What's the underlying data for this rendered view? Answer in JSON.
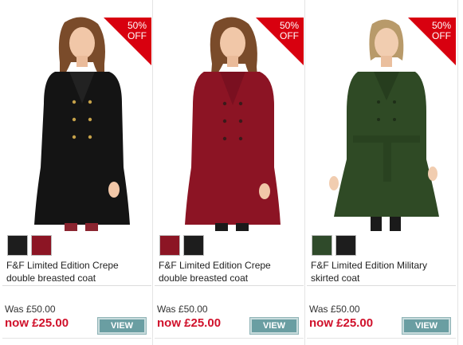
{
  "products": [
    {
      "badge": [
        "50%",
        "OFF"
      ],
      "coat_color": "#141414",
      "swatches": [
        "#1d1d1d",
        "#8c1524"
      ],
      "name": "F&F Limited Edition Crepe double breasted coat",
      "was": "Was £50.00",
      "now": "now £25.00",
      "view": "VIEW"
    },
    {
      "badge": [
        "50%",
        "OFF"
      ],
      "coat_color": "#8c1424",
      "swatches": [
        "#8c1524",
        "#1d1d1d"
      ],
      "name": "F&F Limited Edition Crepe double breasted coat",
      "was": "Was £50.00",
      "now": "now £25.00",
      "view": "VIEW"
    },
    {
      "badge": [
        "50%",
        "OFF"
      ],
      "coat_color": "#2f4a25",
      "swatches": [
        "#2f4a2a",
        "#1d1d1d"
      ],
      "name": "F&F Limited Edition Military skirted coat",
      "was": "Was £50.00",
      "now": "now £25.00",
      "view": "VIEW"
    }
  ],
  "colors": {
    "badge_red": "#d8000f",
    "price_red": "#d0112b",
    "view_button": "#6a9ea2"
  }
}
